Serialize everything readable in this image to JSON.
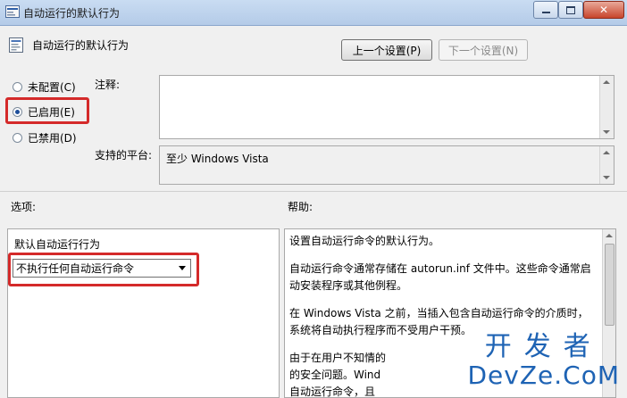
{
  "window": {
    "title": "自动运行的默认行为",
    "controls": {
      "minimize": "minimize-icon",
      "maximize": "maximize-icon",
      "close": "close-icon"
    }
  },
  "header": {
    "policy_name": "自动运行的默认行为",
    "prev_button": "上一个设置(P)",
    "next_button": "下一个设置(N)"
  },
  "radios": {
    "not_configured": "未配置(C)",
    "enabled": "已启用(E)",
    "disabled": "已禁用(D)",
    "selected": "enabled"
  },
  "comment": {
    "label": "注释:",
    "value": ""
  },
  "platform": {
    "label": "支持的平台:",
    "value": "至少 Windows Vista"
  },
  "options": {
    "label": "选项:",
    "field_label": "默认自动运行行为",
    "select_value": "不执行任何自动运行命令"
  },
  "help": {
    "label": "帮助:",
    "paragraphs": [
      "设置自动运行命令的默认行为。",
      "自动运行命令通常存储在 autorun.inf 文件中。这些命令通常启动安装程序或其他例程。",
      "在 Windows Vista 之前，当插入包含自动运行命令的介质时，系统将自动执行程序而不受用户干预。",
      "由于在用户不知情的",
      "的安全问题。Wind",
      "自动运行命令，且"
    ]
  },
  "watermark": {
    "cn": "开发者",
    "en": "DevZe.CoM"
  },
  "colors": {
    "highlight": "#d42a2a",
    "titlebar": "#c9dcf2",
    "watermark": "#1e63b4"
  }
}
